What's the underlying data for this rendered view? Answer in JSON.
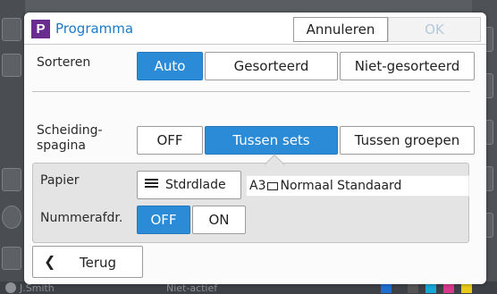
{
  "background": {
    "status_user": "J.Smith",
    "status_state": "Niet-actief",
    "ink_colors": [
      "#1e6fd0",
      "#222222",
      "#17a8d8",
      "#d63a8a",
      "#e8c91a"
    ]
  },
  "dialog": {
    "logo_letter": "P",
    "title": "Programma",
    "cancel_label": "Annuleren",
    "ok_label": "OK",
    "ok_enabled": false
  },
  "sort": {
    "label": "Sorteren",
    "options": [
      "Auto",
      "Gesorteerd",
      "Niet-gesorteerd"
    ],
    "selected": "Auto"
  },
  "separator": {
    "label_line1": "Scheiding-",
    "label_line2": "spagina",
    "options": [
      "OFF",
      "Tussen sets",
      "Tussen groepen"
    ],
    "selected": "Tussen sets"
  },
  "paper": {
    "label": "Papier",
    "tray_label": "Stdrdlade",
    "size": "A3",
    "type": "Normaal Standaard"
  },
  "numbering": {
    "label": "Nummerafdr.",
    "options": [
      "OFF",
      "ON"
    ],
    "selected": "OFF"
  },
  "back_label": "Terug",
  "colors": {
    "accent": "#2b8bd6",
    "title": "#1b7ac7",
    "logo": "#6b2c8f"
  }
}
